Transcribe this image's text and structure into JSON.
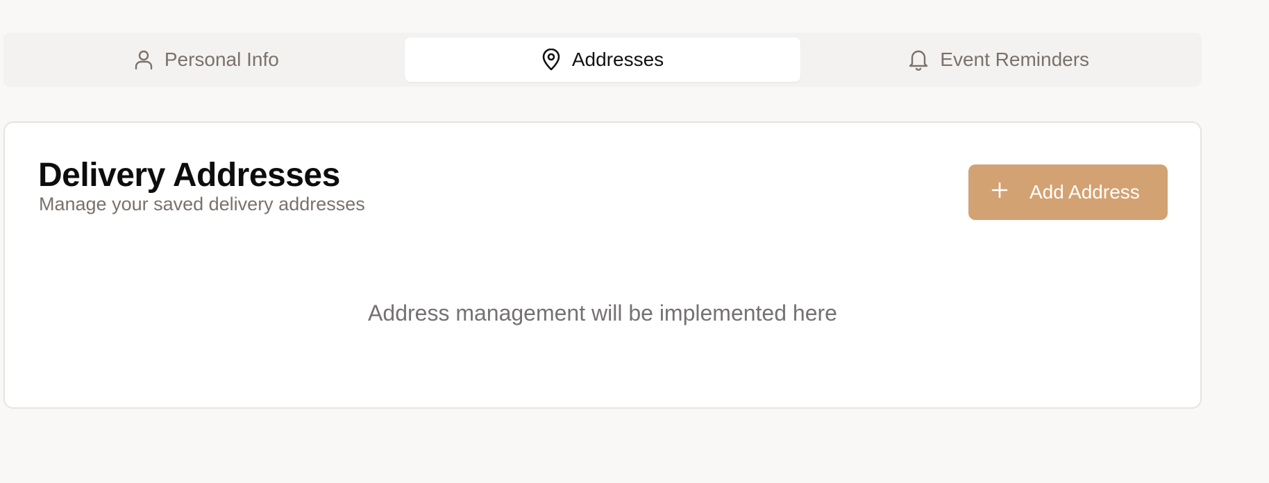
{
  "tabs": [
    {
      "label": "Personal Info",
      "icon": "user-icon",
      "active": false
    },
    {
      "label": "Addresses",
      "icon": "map-pin-icon",
      "active": true
    },
    {
      "label": "Event Reminders",
      "icon": "bell-icon",
      "active": false
    }
  ],
  "card": {
    "title": "Delivery Addresses",
    "subtitle": "Manage your saved delivery addresses",
    "add_button_label": "Add Address",
    "empty_message": "Address management will be implemented here"
  },
  "colors": {
    "accent": "#d2a273",
    "page_background": "#f9f8f6",
    "muted_text": "#7a716b"
  }
}
